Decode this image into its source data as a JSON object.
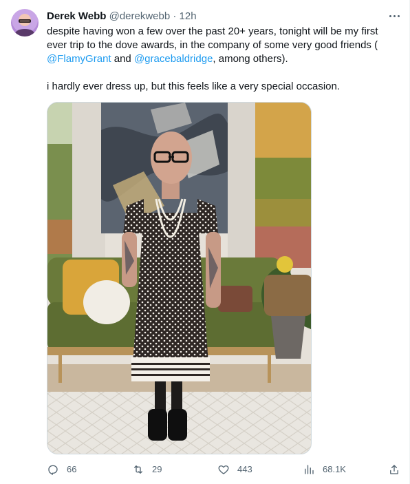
{
  "tweet": {
    "author_name": "Derek Webb",
    "author_handle": "@derekwebb",
    "separator": "·",
    "timestamp": "12h",
    "text_part1": "despite having won a few over the past 20+ years, tonight will be my first ever trip to the dove awards, in the company of some very good friends ( ",
    "mention1": "@FlamyGrant",
    "text_part2": " and ",
    "mention2": "@gracebaldridge",
    "text_part3": ", among others).",
    "text_para2": "i hardly ever dress up, but this feels like a very special occasion."
  },
  "actions": {
    "replies": "66",
    "retweets": "29",
    "likes": "443",
    "views": "68.1K"
  },
  "icons": {
    "more": "more-icon",
    "reply": "reply-icon",
    "retweet": "retweet-icon",
    "like": "heart-icon",
    "views": "views-icon",
    "share": "share-icon"
  },
  "colors": {
    "link": "#1d9bf0",
    "secondary": "#536471",
    "primary_text": "#0f1419"
  }
}
